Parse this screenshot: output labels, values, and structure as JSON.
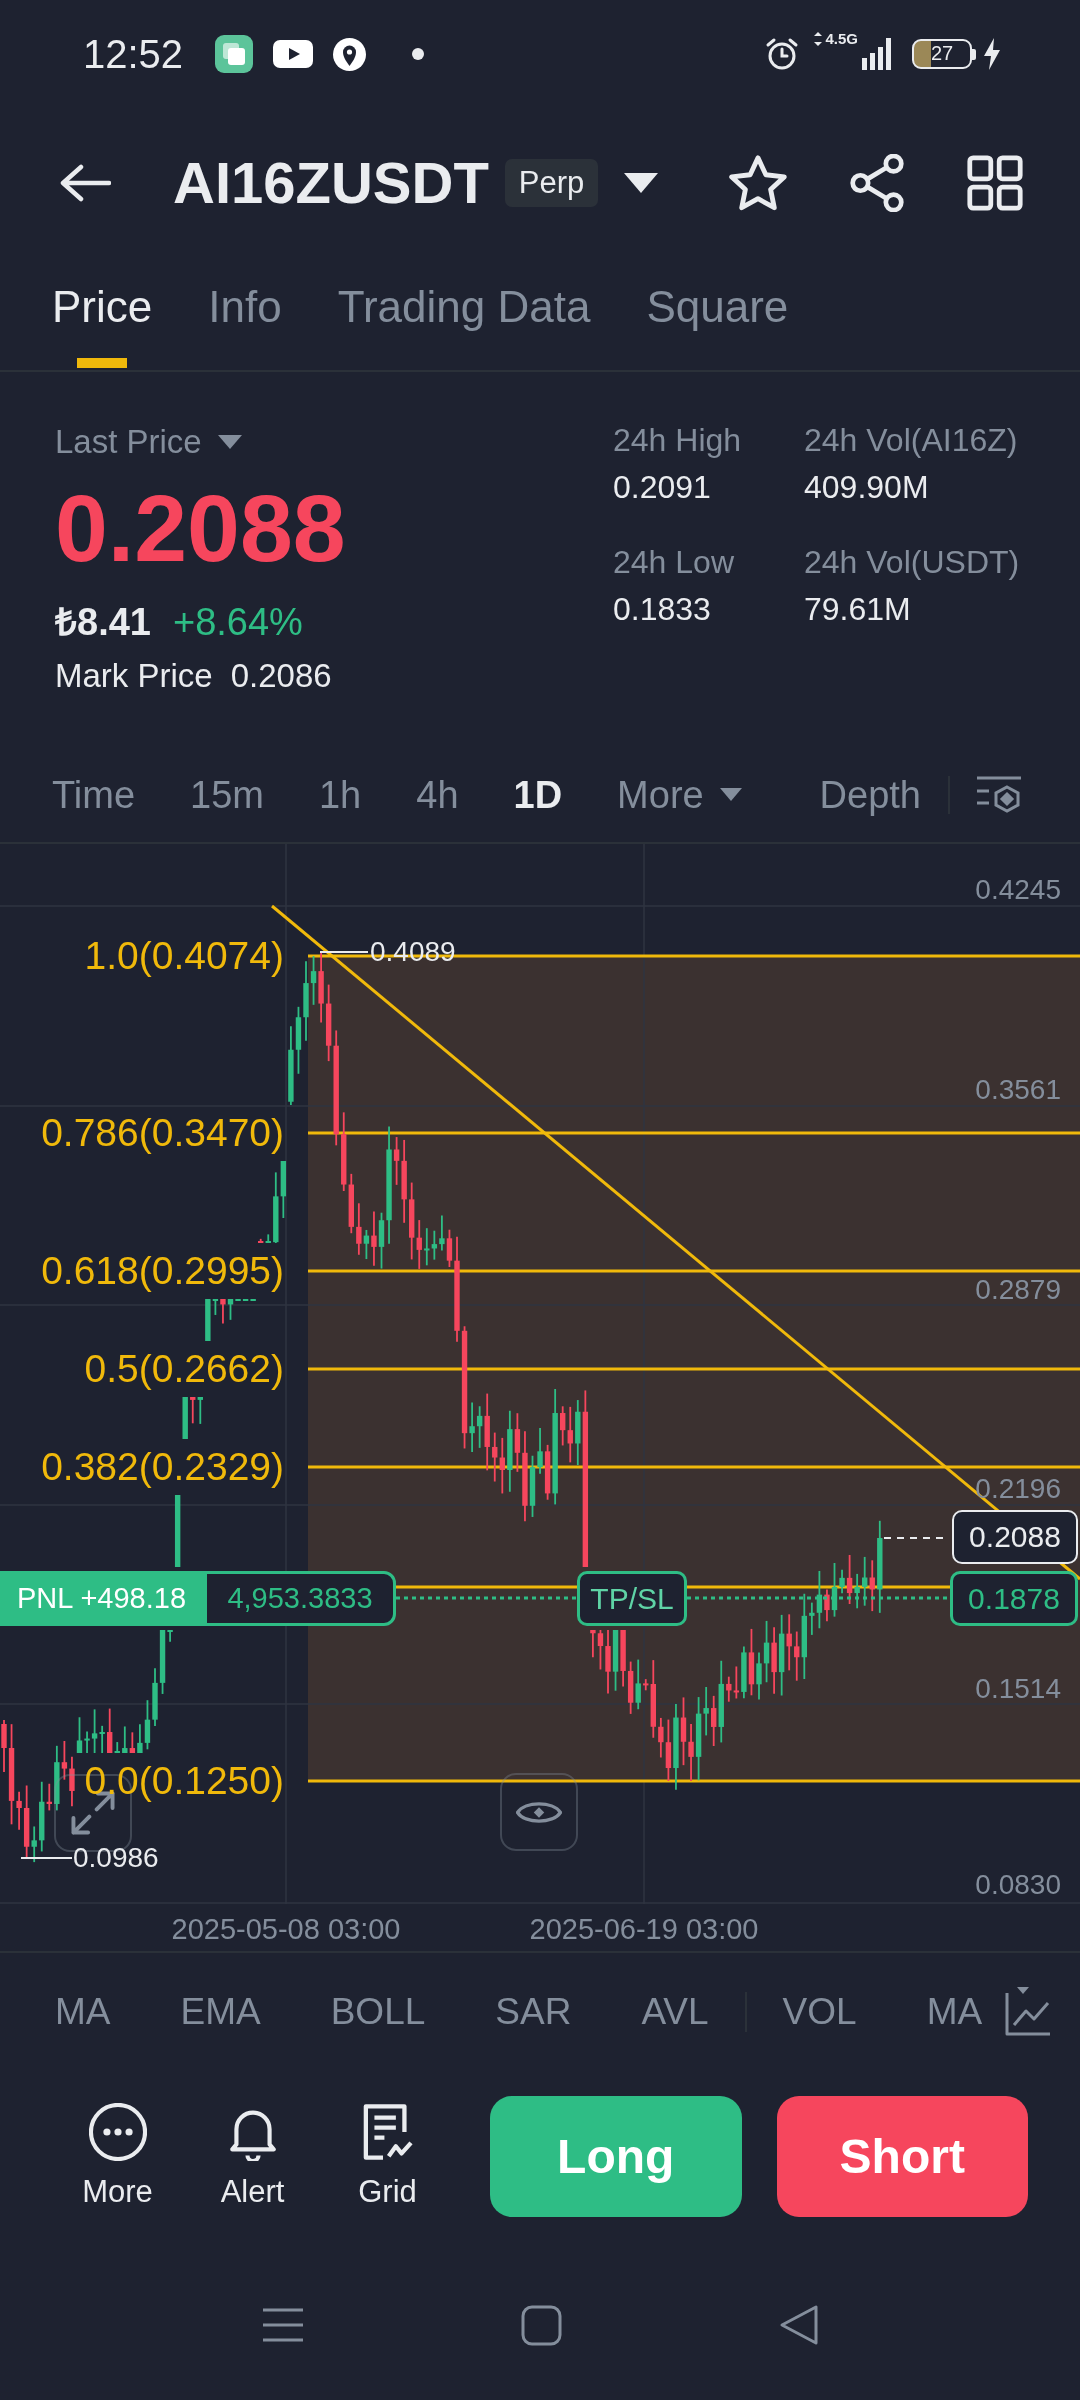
{
  "status_bar": {
    "time": "12:52",
    "network": "4.5G",
    "battery": "27"
  },
  "header": {
    "symbol": "AI16ZUSDT",
    "contract_type": "Perp"
  },
  "tabs": [
    {
      "label": "Price",
      "selected": true
    },
    {
      "label": "Info",
      "selected": false
    },
    {
      "label": "Trading Data",
      "selected": false
    },
    {
      "label": "Square",
      "selected": false
    }
  ],
  "ticker": {
    "last_price_label": "Last Price",
    "last_price": "0.2088",
    "tick_down": true,
    "fiat_price": "₺8.41",
    "change": "+8.64%",
    "mark_price_label": "Mark Price",
    "mark_price": "0.2086"
  },
  "stats": [
    {
      "label": "24h High",
      "value": "0.2091"
    },
    {
      "label": "24h Vol(AI16Z)",
      "value": "409.90M"
    },
    {
      "label": "24h Low",
      "value": "0.1833"
    },
    {
      "label": "24h Vol(USDT)",
      "value": "79.61M"
    }
  ],
  "intervals": [
    {
      "label": "Time",
      "selected": false
    },
    {
      "label": "15m",
      "selected": false
    },
    {
      "label": "1h",
      "selected": false
    },
    {
      "label": "4h",
      "selected": false
    },
    {
      "label": "1D",
      "selected": true
    }
  ],
  "more_intervals": "More",
  "depth": "Depth",
  "chart": {
    "price_axis": [
      "0.4245",
      "0.3561",
      "0.2879",
      "0.2196",
      "0.1514",
      "0.0830"
    ],
    "fib_levels": [
      "1.0(0.4074)",
      "0.786(0.3470)",
      "0.618(0.2995)",
      "0.5(0.2662)",
      "0.382(0.2329)",
      "0.0(0.1250)"
    ],
    "high_marker": "0.4089",
    "low_marker": "0.0986",
    "last_price_tag": "0.2088",
    "position": {
      "pnl": "PNL +498.18",
      "amount": "4,953.3833",
      "tp_sl": "TP/SL",
      "price": "0.1878"
    },
    "date_axis": [
      "2025-05-08 03:00",
      "2025-06-19 03:00"
    ]
  },
  "indicators": {
    "main": [
      "MA",
      "EMA",
      "BOLL",
      "SAR",
      "AVL"
    ],
    "sub": [
      "VOL",
      "MA"
    ]
  },
  "tools": [
    {
      "label": "More"
    },
    {
      "label": "Alert"
    },
    {
      "label": "Grid"
    }
  ],
  "buttons": {
    "long": "Long",
    "short": "Short"
  }
}
